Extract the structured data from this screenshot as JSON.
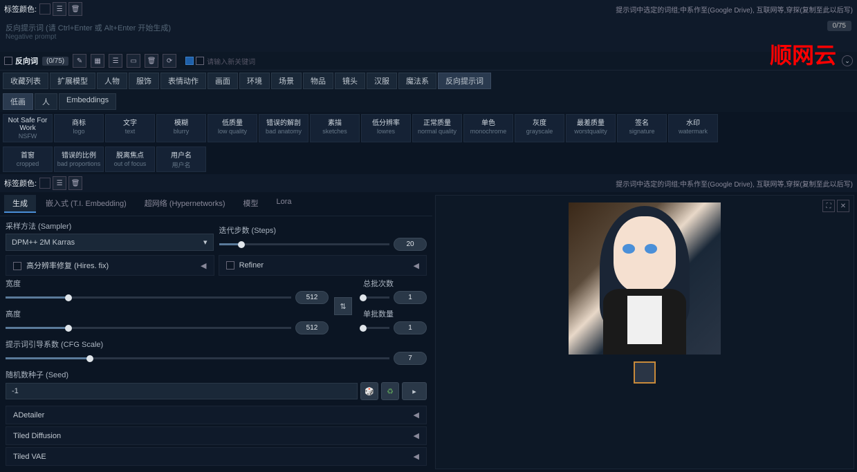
{
  "watermark": "顺网云",
  "top": {
    "color_label": "标签颜色:",
    "hint": "提示词中选定的词组;中系作至(Google Drive), 互联网等,穿探(复制至此以后写)"
  },
  "neg_prompt": {
    "line1": "反向提示词 (请 Ctrl+Enter 或 Alt+Enter 开始生成)",
    "line2": "Negative prompt",
    "counter": "0/75"
  },
  "neg_tab": {
    "label": "反向词",
    "count": "(0/75)",
    "input_hint": "请输入新关键词"
  },
  "category_tabs": [
    "收藏列表",
    "扩展模型",
    "人物",
    "服饰",
    "表情动作",
    "画面",
    "环境",
    "场景",
    "物品",
    "镜头",
    "汉服",
    "魔法系",
    "反向提示词"
  ],
  "sub_tabs": [
    "低画",
    "人",
    "Embeddings"
  ],
  "tags_row1": [
    {
      "cn": "Not Safe For Work",
      "en": "NSFW"
    },
    {
      "cn": "商标",
      "en": "logo"
    },
    {
      "cn": "文字",
      "en": "text"
    },
    {
      "cn": "模糊",
      "en": "blurry"
    },
    {
      "cn": "低质量",
      "en": "low quality"
    },
    {
      "cn": "错误的解剖",
      "en": "bad anatomy"
    },
    {
      "cn": "素描",
      "en": "sketches"
    },
    {
      "cn": "低分辨率",
      "en": "lowres"
    },
    {
      "cn": "正常质量",
      "en": "normal quality"
    },
    {
      "cn": "单色",
      "en": "monochrome"
    },
    {
      "cn": "灰度",
      "en": "grayscale"
    },
    {
      "cn": "最差质量",
      "en": "worstquality"
    },
    {
      "cn": "签名",
      "en": "signature"
    },
    {
      "cn": "水印",
      "en": "watermark"
    }
  ],
  "tags_row2": [
    {
      "cn": "首窗",
      "en": "cropped"
    },
    {
      "cn": "错误的比例",
      "en": "bad proportions"
    },
    {
      "cn": "脱离焦点",
      "en": "out of focus"
    },
    {
      "cn": "用户名",
      "en": "用户名"
    }
  ],
  "bottom_hint": {
    "color_label": "标签颜色:",
    "text": "提示词中选定的词组;中系作至(Google Drive), 互联网等,穿探(复制至此以后写)"
  },
  "gen_tabs": [
    "生成",
    "嵌入式 (T.I. Embedding)",
    "超网络 (Hypernetworks)",
    "模型",
    "Lora"
  ],
  "sampler": {
    "label": "采样方法 (Sampler)",
    "value": "DPM++ 2M Karras"
  },
  "steps": {
    "label": "迭代步数 (Steps)",
    "value": "20"
  },
  "hires": {
    "label": "高分辨率修复 (Hires. fix)"
  },
  "refiner": {
    "label": "Refiner"
  },
  "width": {
    "label": "宽度",
    "value": "512"
  },
  "height": {
    "label": "高度",
    "value": "512"
  },
  "batch_count": {
    "label": "总批次数",
    "value": "1"
  },
  "batch_size": {
    "label": "单批数量",
    "value": "1"
  },
  "cfg": {
    "label": "提示词引导系数 (CFG Scale)",
    "value": "7"
  },
  "seed": {
    "label": "随机数种子 (Seed)",
    "value": "-1"
  },
  "accordions": [
    "ADetailer",
    "Tiled Diffusion",
    "Tiled VAE"
  ],
  "swap_icon": "⇅",
  "dice_icon": "🎲",
  "recycle_icon": "♻"
}
